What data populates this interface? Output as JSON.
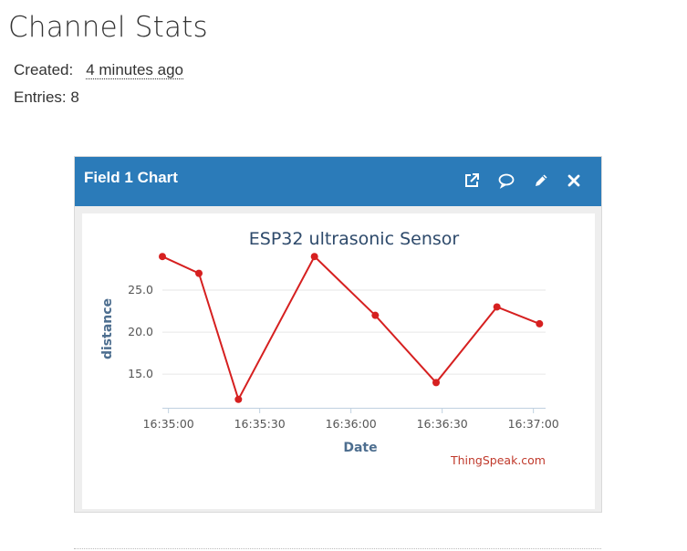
{
  "page": {
    "title": "Channel Stats",
    "created_label": "Created:",
    "created_value": "4 minutes ago",
    "entries_label": "Entries:",
    "entries_value": "8"
  },
  "panel": {
    "title": "Field 1 Chart",
    "icons": [
      "external-link-icon",
      "comment-icon",
      "pencil-icon",
      "close-icon"
    ],
    "header_color": "#2b7bb9"
  },
  "chart_data": {
    "type": "line",
    "title": "ESP32 ultrasonic Sensor",
    "xlabel": "Date",
    "ylabel": "distance",
    "credit": "ThingSpeak.com",
    "x": [
      "16:34:58",
      "16:35:10",
      "16:35:23",
      "16:35:48",
      "16:36:08",
      "16:36:28",
      "16:36:48",
      "16:37:02"
    ],
    "x_ticks": [
      "16:35:00",
      "16:35:30",
      "16:36:00",
      "16:36:30",
      "16:37:00"
    ],
    "xlim": [
      "16:34:58",
      "16:37:04"
    ],
    "y_ticks": [
      15.0,
      20.0,
      25.0
    ],
    "y_tick_labels": [
      "15.0",
      "20.0",
      "25.0"
    ],
    "ylim": [
      11,
      30
    ],
    "series": [
      {
        "values": [
          29,
          27,
          12,
          29,
          22,
          14,
          23,
          21
        ],
        "color": "#d62020"
      }
    ],
    "grid": true
  }
}
